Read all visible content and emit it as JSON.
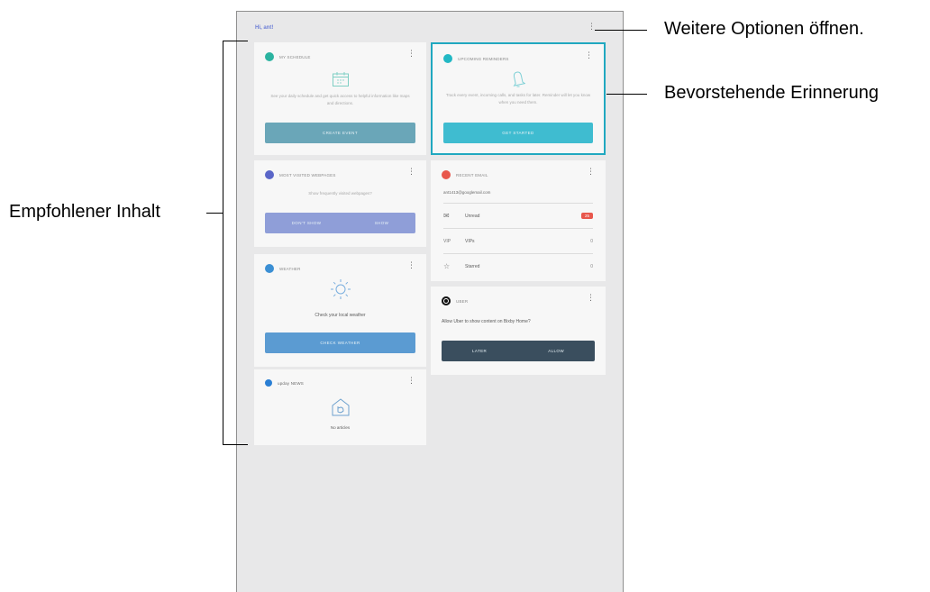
{
  "device": {
    "greeting": "Hi, ant!",
    "more_icon": "more-vertical-icon"
  },
  "cards": {
    "schedule": {
      "title": "MY SCHEDULE",
      "description": "See your daily schedule and get quick access to helpful information like maps and directions.",
      "button": "CREATE EVENT",
      "icon_color": "#2bb3a0"
    },
    "reminders": {
      "title": "UPCOMING REMINDERS",
      "description": "Track every event, incoming calls, and tasks for later. Reminder will let you know when you need them.",
      "button": "GET STARTED",
      "icon_color": "#22b8c4"
    },
    "webpages": {
      "title": "MOST VISITED WEBPAGES",
      "description": "Show frequently visited webpages?",
      "button_left": "DON'T SHOW",
      "button_right": "SHOW",
      "icon_color": "#5a66c8"
    },
    "email": {
      "title": "RECENT EMAIL",
      "address": "ant1413@googlemail.com",
      "rows": [
        {
          "icon": "envelope-icon",
          "label": "Unread",
          "count": "25"
        },
        {
          "icon": "vip-icon",
          "label": "VIPs",
          "count": "0"
        },
        {
          "icon": "star-icon",
          "label": "Starred",
          "count": "0"
        }
      ],
      "icon_color": "#e8574c"
    },
    "weather": {
      "title": "WEATHER",
      "description": "Check your local weather",
      "button": "CHECK WEATHER",
      "icon_color": "#3b8fd4"
    },
    "uber": {
      "title": "UBER",
      "description": "Allow Uber to show content on Bixby Home?",
      "button_left": "LATER",
      "button_right": "ALLOW",
      "icon_color": "#111111"
    },
    "news": {
      "title": "upday NEWS",
      "description": "No articles",
      "icon_color": "#2a7fd4"
    }
  },
  "callouts": {
    "more_options": "Weitere Optionen öffnen.",
    "upcoming_reminder": "Bevorstehende Erinnerung",
    "recommended_content": "Empfohlener Inhalt"
  }
}
